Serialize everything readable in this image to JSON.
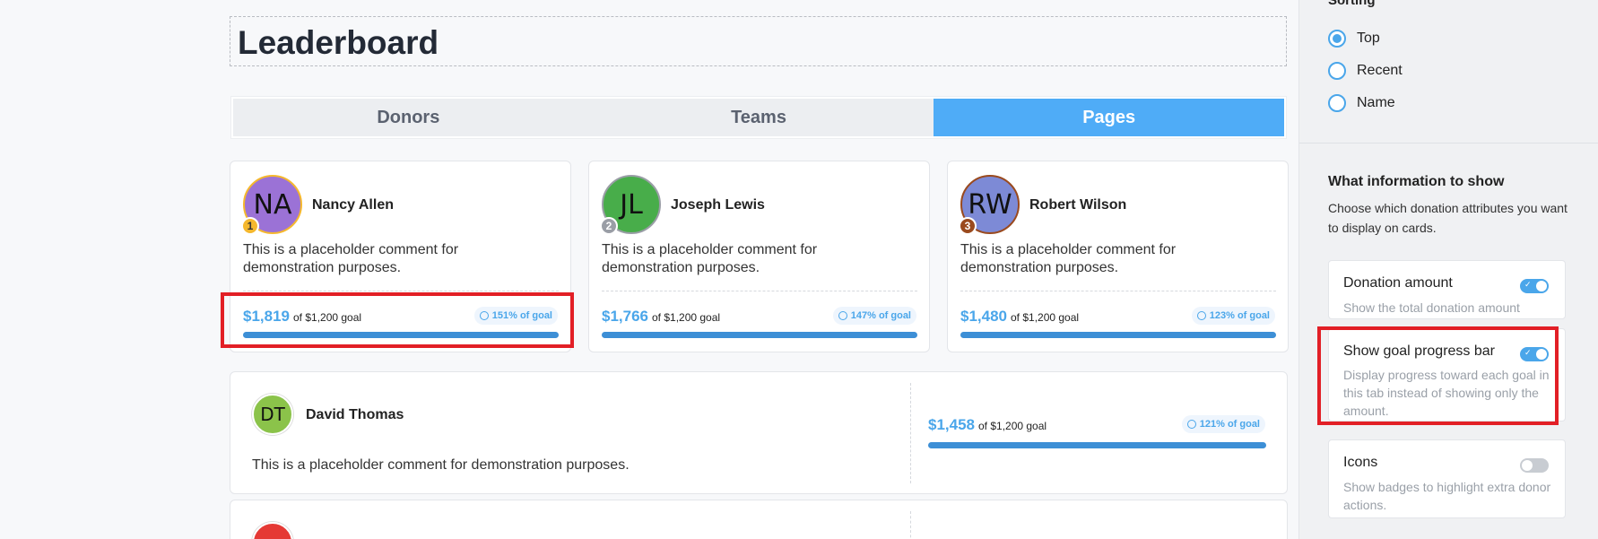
{
  "page": {
    "title": "Leaderboard",
    "tabs": [
      "Donors",
      "Teams",
      "Pages"
    ],
    "active_tab": "Pages"
  },
  "cards": [
    {
      "initials": "NA",
      "name": "Nancy Allen",
      "rank": "1",
      "avatar_color": "#9b72d6",
      "ring_color": "#f5b82e",
      "rank_color": "#f5b82e",
      "comment": "This is a placeholder comment for demonstration purposes.",
      "amount": "$1,819",
      "goal": "of $1,200 goal",
      "percent": "151% of goal",
      "progress": 1.0
    },
    {
      "initials": "JL",
      "name": "Joseph Lewis",
      "rank": "2",
      "avatar_color": "#48ad4a",
      "ring_color": "#9a9ea6",
      "rank_color": "#9a9ea6",
      "comment": "This is a placeholder comment for demonstration purposes.",
      "amount": "$1,766",
      "goal": "of $1,200 goal",
      "percent": "147% of goal",
      "progress": 1.0
    },
    {
      "initials": "RW",
      "name": "Robert Wilson",
      "rank": "3",
      "avatar_color": "#7d8ad6",
      "ring_color": "#9a4a1e",
      "rank_color": "#9a4a1e",
      "comment": "This is a placeholder comment for demonstration purposes.",
      "amount": "$1,480",
      "goal": "of $1,200 goal",
      "percent": "123% of goal",
      "progress": 1.0
    }
  ],
  "rows": [
    {
      "initials": "DT",
      "name": "David Thomas",
      "avatar_color": "#8bc34a",
      "comment": "This is a placeholder comment for demonstration purposes.",
      "amount": "$1,458",
      "goal": "of $1,200 goal",
      "percent": "121% of goal",
      "progress": 1.0
    },
    {
      "initials": "",
      "avatar_color": "#e53935"
    }
  ],
  "sidebar": {
    "sorting_heading": "Sorting",
    "sort_options": [
      "Top",
      "Recent",
      "Name"
    ],
    "selected_sort": "Top",
    "info_title": "What information to show",
    "info_desc": "Choose which donation attributes you want to display on cards.",
    "options": [
      {
        "label": "Donation amount",
        "desc": "Show the total donation amount",
        "enabled": true
      },
      {
        "label": "Show goal progress bar",
        "desc": "Display progress toward each goal in this tab instead of showing only the amount.",
        "enabled": true
      },
      {
        "label": "Icons",
        "desc": "Show badges to highlight extra donor actions.",
        "enabled": false
      }
    ]
  },
  "colors": {
    "accent": "#4facf7",
    "progress": "#3d8fd6",
    "highlight": "#e21f26"
  }
}
